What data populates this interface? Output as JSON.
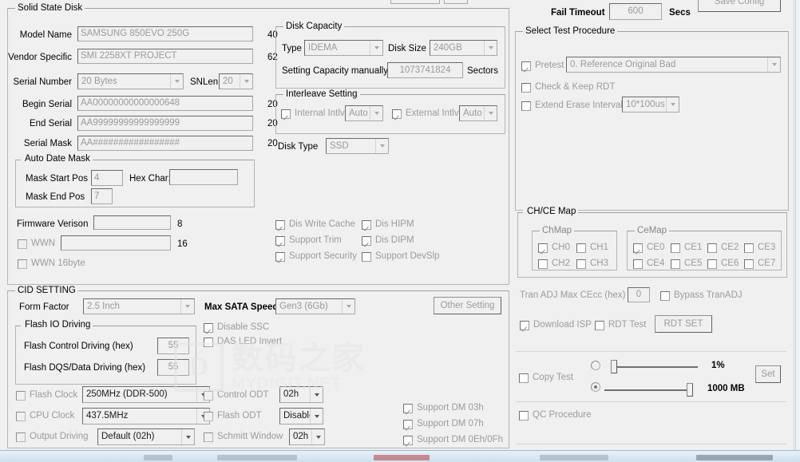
{
  "app": {
    "watermark_cn": "数码之家",
    "watermark_en": "MYDIGIT.NET",
    "watermark_logo": "D"
  },
  "ssd": {
    "legend": "Solid State Disk",
    "model_name_label": "Model Name",
    "model_name_value": "SAMSUNG 850EVO 250G",
    "model_name_len": "40",
    "vendor_specific_label": "Vendor Specific",
    "vendor_specific_value": "SMI 2258XT PROJECT",
    "vendor_specific_len": "62",
    "serial_number_label": "Serial Number",
    "serial_number_value": "20 Bytes",
    "snlen_label": "SNLen",
    "snlen_value": "20",
    "begin_serial_label": "Begin Serial",
    "begin_serial_value": "AA00000000000000648",
    "begin_serial_len": "20",
    "end_serial_label": "End Serial",
    "end_serial_value": "AA99999999999999999",
    "end_serial_len": "20",
    "serial_mask_label": "Serial Mask",
    "serial_mask_value": "AA#################",
    "serial_mask_len": "20",
    "auto_date_mask_label": "Auto Date Mask",
    "auto_date_mask_checked": false,
    "mask_start_pos_label": "Mask Start Pos",
    "mask_start_pos_value": "4",
    "hex_char_label": "Hex Char:",
    "hex_char_value": "",
    "mask_end_pos_label": "Mask End Pos",
    "mask_end_pos_value": "7",
    "firmware_version_label": "Firmware Verison",
    "firmware_version_value": "",
    "firmware_version_len": "8",
    "wwn_label": "WWN",
    "wwn_value": "",
    "wwn_len": "16",
    "wwn16byte_label": "WWN 16byte"
  },
  "disk_capacity": {
    "legend": "Disk Capacity",
    "type_label": "Type",
    "type_value": "IDEMA",
    "disk_size_label": "Disk Size",
    "disk_size_value": "240GB",
    "setting_capacity_label": "Setting Capacity manually",
    "setting_capacity_value": "1073741824",
    "sectors_label": "Sectors"
  },
  "interleave": {
    "legend": "Interleave Setting",
    "internal_label": "Internal Intlv",
    "internal_value": "Auto",
    "internal_checked": true,
    "external_label": "External Intlv",
    "external_value": "Auto",
    "external_checked": true
  },
  "disk_type": {
    "label": "Disk Type",
    "value": "SSD"
  },
  "feature_flags": [
    {
      "label": "Dis Write Cache",
      "checked": true
    },
    {
      "label": "Support Trim",
      "checked": true
    },
    {
      "label": "Support Security",
      "checked": true
    },
    {
      "label": "Dis HIPM",
      "checked": true
    },
    {
      "label": "Dis DIPM",
      "checked": true
    },
    {
      "label": "Support DevSlp",
      "checked": false
    }
  ],
  "cid": {
    "legend": "CID SETTING",
    "form_factor_label": "Form Factor",
    "form_factor_value": "2.5 Inch",
    "max_sata_label": "Max SATA Speed",
    "max_sata_value": "Gen3 (6Gb)",
    "other_setting_label": "Other Setting",
    "flash_io_legend": "Flash IO Driving",
    "flash_io_checked": false,
    "flash_control_label": "Flash Control Driving (hex)",
    "flash_control_value": "55",
    "flash_dqs_label": "Flash DQS/Data Driving (hex)",
    "flash_dqs_value": "55",
    "disable_ssc_label": "Disable SSC",
    "disable_ssc_checked": true,
    "das_led_label": "DAS LED Invert",
    "das_led_checked": false,
    "flash_clock_label": "Flash Clock",
    "flash_clock_value": "250MHz (DDR-500)",
    "cpu_clock_label": "CPU Clock",
    "cpu_clock_value": "437.5MHz",
    "output_driving_label": "Output Driving",
    "output_driving_value": "Default (02h)",
    "control_odt_label": "Control ODT",
    "control_odt_value": "02h",
    "flash_odt_label": "Flash ODT",
    "flash_odt_value": "Disable",
    "schmitt_window_label": "Schmitt Window",
    "schmitt_window_value": "02h",
    "support_dm": [
      {
        "label": "Support DM 03h",
        "checked": true
      },
      {
        "label": "Support DM 07h",
        "checked": true
      },
      {
        "label": "Support DM 0Eh/0Fh",
        "checked": true
      }
    ]
  },
  "right": {
    "fail_timeout_label": "Fail Timeout",
    "fail_timeout_value": "600",
    "secs_label": "Secs",
    "save_config_label": "Save Config",
    "test_procedure_legend": "Select Test Procedure",
    "pretest_label": "Pretest",
    "pretest_checked": true,
    "pretest_value": "0. Reference Original Bad",
    "check_keep_rdt_label": "Check & Keep RDT",
    "check_keep_rdt_checked": false,
    "extend_erase_label": "Extend Erase Interval",
    "extend_erase_checked": false,
    "extend_erase_value": "10*100us",
    "chce_map_legend": "CH/CE Map",
    "chce_map_checked": false,
    "chmap_legend": "ChMap",
    "chmap": [
      {
        "label": "CH0",
        "checked": true
      },
      {
        "label": "CH1",
        "checked": false
      },
      {
        "label": "CH2",
        "checked": false
      },
      {
        "label": "CH3",
        "checked": false
      }
    ],
    "cemap_legend": "CeMap",
    "cemap": [
      {
        "label": "CE0",
        "checked": true
      },
      {
        "label": "CE1",
        "checked": false
      },
      {
        "label": "CE2",
        "checked": false
      },
      {
        "label": "CE3",
        "checked": false
      },
      {
        "label": "CE4",
        "checked": false
      },
      {
        "label": "CE5",
        "checked": false
      },
      {
        "label": "CE6",
        "checked": false
      },
      {
        "label": "CE7",
        "checked": false
      }
    ],
    "tran_adj_label": "Tran ADJ Max CEcc (hex)",
    "tran_adj_value": "0",
    "bypass_tranadj_label": "Bypass TranADJ",
    "bypass_tranadj_checked": false,
    "download_isp_label": "Download ISP",
    "download_isp_checked": true,
    "rdt_test_label": "RDT Test",
    "rdt_test_checked": false,
    "rdt_set_label": "RDT SET",
    "copy_test_label": "Copy Test",
    "copy_test_checked": false,
    "percent_value": "1%",
    "percent_selected": false,
    "size_value": "1000 MB",
    "size_selected": true,
    "set_label": "Set",
    "qc_procedure_label": "QC Procedure",
    "qc_procedure_checked": false
  }
}
